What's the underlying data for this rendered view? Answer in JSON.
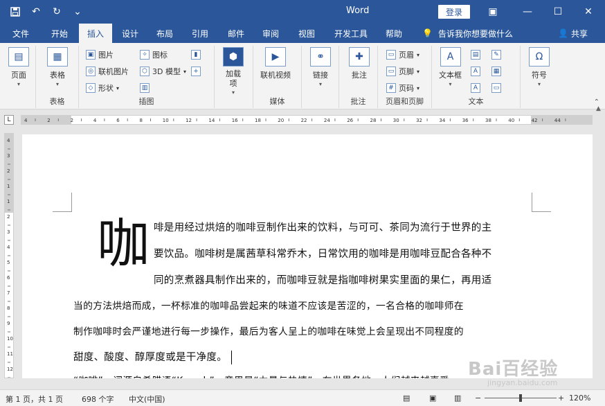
{
  "app": {
    "title": "Word",
    "login_label": "登录"
  },
  "qat": {
    "save_icon": "save-icon",
    "undo_icon": "undo-icon",
    "redo_icon": "redo-icon",
    "customize_icon": "customize-icon"
  },
  "tabs": [
    "文件",
    "开始",
    "插入",
    "设计",
    "布局",
    "引用",
    "邮件",
    "审阅",
    "视图",
    "开发工具",
    "帮助"
  ],
  "active_tab": "插入",
  "tellme": "告诉我你想要做什么",
  "share": "共享",
  "ribbon": {
    "pages": {
      "label": "页面",
      "group": ""
    },
    "table": {
      "label": "表格",
      "group": "表格"
    },
    "illustrations": {
      "picture": "图片",
      "online_picture": "联机图片",
      "shapes": "形状",
      "icons": "图标",
      "model3d": "3D 模型",
      "group": "插图"
    },
    "addins": {
      "label": "加载\n项"
    },
    "media": {
      "online_video": "联机视频",
      "group": "媒体"
    },
    "links": {
      "label": "链接"
    },
    "comments": {
      "label": "批注",
      "group": "批注"
    },
    "header_footer": {
      "header": "页眉",
      "footer": "页脚",
      "page_number": "页码",
      "group": "页眉和页脚"
    },
    "text": {
      "textbox": "文本框",
      "group": "文本"
    },
    "symbols": {
      "label": "符号",
      "symbol_glyph": "Ω"
    }
  },
  "ruler": {
    "h_ticks": [
      "4",
      "2",
      "2",
      "4",
      "6",
      "8",
      "10",
      "12",
      "14",
      "16",
      "18",
      "20",
      "22",
      "24",
      "26",
      "28",
      "30",
      "32",
      "34",
      "36",
      "38",
      "40",
      "42",
      "44"
    ],
    "v_ticks": [
      "4",
      "3",
      "2",
      "1",
      "1",
      "2",
      "3",
      "4",
      "5",
      "6",
      "7",
      "8",
      "9",
      "10",
      "11",
      "12"
    ],
    "corner": "L"
  },
  "document": {
    "dropcap": "咖",
    "lines": [
      "啡是用经过烘焙的咖啡豆制作出来的饮料，与可可、茶同为流行于世界的主",
      "要饮品。咖啡树是属茜草科常乔木，日常饮用的咖啡是用咖啡豆配合各种不",
      "同的烹煮器具制作出来的，而咖啡豆就是指咖啡树果实里面的果仁，再用适",
      "当的方法烘焙而成，一杯标准的咖啡品尝起来的味道不应该是苦涩的，一名合格的咖啡师在",
      "制作咖啡时会严谨地进行每一步操作，最后为客人呈上的咖啡在味觉上会呈现出不同程度的",
      "甜度、酸度、醇厚度或是干净度。",
      "“咖啡”一词源自希腊语“Kaweh”，意思是“力量与热情”。在世界各地，人们越来越喜爱"
    ]
  },
  "status": {
    "page": "第 1 页，共 1 页",
    "words": "698 个字",
    "lang": "中文(中国)",
    "zoom": "120%"
  },
  "watermark": {
    "logo": "Bai百经验",
    "url": "jingyan.baidu.com"
  }
}
